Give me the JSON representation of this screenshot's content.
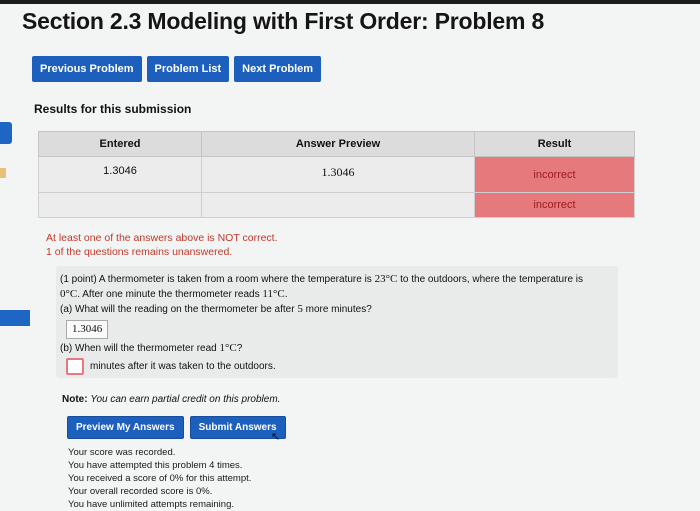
{
  "title": "Section 2.3 Modeling with First Order: Problem 8",
  "nav": {
    "previous": "Previous Problem",
    "list": "Problem List",
    "next": "Next Problem"
  },
  "results": {
    "label": "Results for this submission",
    "headers": [
      "Entered",
      "Answer Preview",
      "Result"
    ],
    "rows": [
      {
        "entered": "1.3046",
        "preview": "1.3046",
        "result": "incorrect"
      },
      {
        "entered": "",
        "preview": "",
        "result": "incorrect"
      }
    ]
  },
  "warnings": [
    "At least one of the answers above is NOT correct.",
    "1 of the questions remains unanswered."
  ],
  "problem": {
    "intro_a": "(1 point) A thermometer is taken from a room where the temperature is",
    "temp_room": "23°C",
    "intro_b": "to the outdoors, where the temperature is",
    "temp_out": "0°C",
    "intro_c": ". After one minute the thermometer reads",
    "temp_read": "11°C",
    "intro_d": ".",
    "part_a_1": "(a) What will the reading on the thermometer be after",
    "part_a_num": "5",
    "part_a_2": "more minutes?",
    "answer_a": "1.3046",
    "part_b_1": "(b) When will the thermometer read",
    "part_b_temp": "1°C",
    "part_b_2": "?",
    "answer_b_suffix": "minutes after it was taken to the outdoors."
  },
  "note": {
    "label": "Note:",
    "text": "You can earn partial credit on this problem."
  },
  "buttons": {
    "preview": "Preview My Answers",
    "submit": "Submit Answers"
  },
  "status": [
    "Your score was recorded.",
    "You have attempted this problem 4 times.",
    "You received a score of 0% for this attempt.",
    "Your overall recorded score is 0%.",
    "You have unlimited attempts remaining."
  ],
  "colors": {
    "accent": "#1d5fbd",
    "incorrect_bg": "#e5797b",
    "warning_text": "#c0392b"
  }
}
